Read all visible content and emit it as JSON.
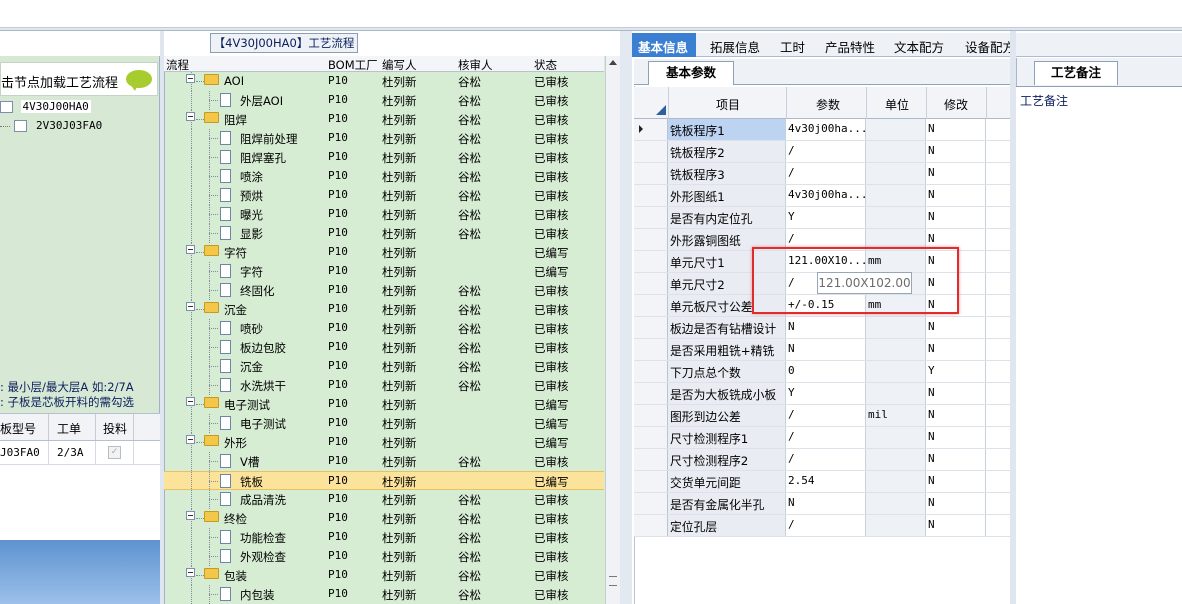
{
  "left_panel": {
    "title": "击节点加载工艺流程",
    "tree": [
      "4V30J00HA0",
      "2V30J03FA0"
    ],
    "note_line1": ": 最小层/最大层A 如:2/7A",
    "note_line2": ": 子板是芯板开料的需勾选",
    "grid_headers": [
      "板型号",
      "工单",
      "投料"
    ],
    "grid_row": {
      "model": "J03FA0",
      "order": "2/3A"
    }
  },
  "middle_panel": {
    "tab_title": "【4V30J00HA0】工艺流程",
    "headers": [
      "流程",
      "BOM工厂",
      "编写人",
      "核审人",
      "状态"
    ],
    "rows": [
      {
        "name": "AOI",
        "level": 0,
        "bom": "P10",
        "writer": "杜列新",
        "reviewer": "谷松",
        "status": "已审核"
      },
      {
        "name": "外层AOI",
        "level": 1,
        "bom": "P10",
        "writer": "杜列新",
        "reviewer": "谷松",
        "status": "已审核"
      },
      {
        "name": "阻焊",
        "level": 0,
        "bom": "P10",
        "writer": "杜列新",
        "reviewer": "谷松",
        "status": "已审核"
      },
      {
        "name": "阻焊前处理",
        "level": 1,
        "bom": "P10",
        "writer": "杜列新",
        "reviewer": "谷松",
        "status": "已审核"
      },
      {
        "name": "阻焊塞孔",
        "level": 1,
        "bom": "P10",
        "writer": "杜列新",
        "reviewer": "谷松",
        "status": "已审核"
      },
      {
        "name": "喷涂",
        "level": 1,
        "bom": "P10",
        "writer": "杜列新",
        "reviewer": "谷松",
        "status": "已审核"
      },
      {
        "name": "预烘",
        "level": 1,
        "bom": "P10",
        "writer": "杜列新",
        "reviewer": "谷松",
        "status": "已审核"
      },
      {
        "name": "曝光",
        "level": 1,
        "bom": "P10",
        "writer": "杜列新",
        "reviewer": "谷松",
        "status": "已审核"
      },
      {
        "name": "显影",
        "level": 1,
        "bom": "P10",
        "writer": "杜列新",
        "reviewer": "谷松",
        "status": "已审核"
      },
      {
        "name": "字符",
        "level": 0,
        "bom": "P10",
        "writer": "杜列新",
        "reviewer": "",
        "status": "已编写"
      },
      {
        "name": "字符",
        "level": 1,
        "bom": "P10",
        "writer": "杜列新",
        "reviewer": "",
        "status": "已编写"
      },
      {
        "name": "终固化",
        "level": 1,
        "bom": "P10",
        "writer": "杜列新",
        "reviewer": "谷松",
        "status": "已审核"
      },
      {
        "name": "沉金",
        "level": 0,
        "bom": "P10",
        "writer": "杜列新",
        "reviewer": "谷松",
        "status": "已审核"
      },
      {
        "name": "喷砂",
        "level": 1,
        "bom": "P10",
        "writer": "杜列新",
        "reviewer": "谷松",
        "status": "已审核"
      },
      {
        "name": "板边包胶",
        "level": 1,
        "bom": "P10",
        "writer": "杜列新",
        "reviewer": "谷松",
        "status": "已审核"
      },
      {
        "name": "沉金",
        "level": 1,
        "bom": "P10",
        "writer": "杜列新",
        "reviewer": "谷松",
        "status": "已审核"
      },
      {
        "name": "水洗烘干",
        "level": 1,
        "bom": "P10",
        "writer": "杜列新",
        "reviewer": "谷松",
        "status": "已审核"
      },
      {
        "name": "电子测试",
        "level": 0,
        "bom": "P10",
        "writer": "杜列新",
        "reviewer": "",
        "status": "已编写"
      },
      {
        "name": "电子测试",
        "level": 1,
        "bom": "P10",
        "writer": "杜列新",
        "reviewer": "",
        "status": "已编写"
      },
      {
        "name": "外形",
        "level": 0,
        "bom": "P10",
        "writer": "杜列新",
        "reviewer": "",
        "status": "已编写"
      },
      {
        "name": "V槽",
        "level": 1,
        "bom": "P10",
        "writer": "杜列新",
        "reviewer": "谷松",
        "status": "已审核"
      },
      {
        "name": "铣板",
        "level": 1,
        "bom": "P10",
        "writer": "杜列新",
        "reviewer": "",
        "status": "已编写",
        "selected": true
      },
      {
        "name": "成品清洗",
        "level": 1,
        "bom": "P10",
        "writer": "杜列新",
        "reviewer": "谷松",
        "status": "已审核"
      },
      {
        "name": "终检",
        "level": 0,
        "bom": "P10",
        "writer": "杜列新",
        "reviewer": "谷松",
        "status": "已审核"
      },
      {
        "name": "功能检查",
        "level": 1,
        "bom": "P10",
        "writer": "杜列新",
        "reviewer": "谷松",
        "status": "已审核"
      },
      {
        "name": "外观检查",
        "level": 1,
        "bom": "P10",
        "writer": "杜列新",
        "reviewer": "谷松",
        "status": "已审核"
      },
      {
        "name": "包装",
        "level": 0,
        "bom": "P10",
        "writer": "杜列新",
        "reviewer": "谷松",
        "status": "已审核"
      },
      {
        "name": "内包装",
        "level": 1,
        "bom": "P10",
        "writer": "杜列新",
        "reviewer": "谷松",
        "status": "已审核"
      }
    ]
  },
  "right_tabs": [
    "基本信息",
    "拓展信息",
    "工时",
    "产品特性",
    "文本配方",
    "设备配方"
  ],
  "params": {
    "tab": "基本参数",
    "headers": [
      "项目",
      "参数",
      "单位",
      "修改"
    ],
    "rows": [
      {
        "item": "铣板程序1",
        "value": "4v30j00ha...",
        "unit": "",
        "mod": "N"
      },
      {
        "item": "铣板程序2",
        "value": "/",
        "unit": "",
        "mod": "N"
      },
      {
        "item": "铣板程序3",
        "value": "/",
        "unit": "",
        "mod": "N"
      },
      {
        "item": "外形图纸1",
        "value": "4v30j00ha...",
        "unit": "",
        "mod": "N"
      },
      {
        "item": "是否有内定位孔",
        "value": "Y",
        "unit": "",
        "mod": "N"
      },
      {
        "item": "外形露铜图纸",
        "value": "/",
        "unit": "",
        "mod": "N"
      },
      {
        "item": "单元尺寸1",
        "value": "121.00X10...",
        "unit": "mm",
        "mod": "N"
      },
      {
        "item": "单元尺寸2",
        "value": "/",
        "unit": "",
        "mod": "N"
      },
      {
        "item": "单元板尺寸公差",
        "value": "+/-0.15",
        "unit": "mm",
        "mod": "N"
      },
      {
        "item": "板边是否有钻槽设计",
        "value": "N",
        "unit": "",
        "mod": "N"
      },
      {
        "item": "是否采用粗铣+精铣",
        "value": "N",
        "unit": "",
        "mod": "N"
      },
      {
        "item": "下刀点总个数",
        "value": "0",
        "unit": "",
        "mod": "Y"
      },
      {
        "item": "是否为大板铣成小板",
        "value": "Y",
        "unit": "",
        "mod": "N"
      },
      {
        "item": "图形到边公差",
        "value": "/",
        "unit": "mil",
        "mod": "N"
      },
      {
        "item": "尺寸检测程序1",
        "value": "/",
        "unit": "",
        "mod": "N"
      },
      {
        "item": "尺寸检测程序2",
        "value": "/",
        "unit": "",
        "mod": "N"
      },
      {
        "item": "交货单元间距",
        "value": "2.54",
        "unit": "",
        "mod": "N"
      },
      {
        "item": "是否有金属化半孔",
        "value": "N",
        "unit": "",
        "mod": "N"
      },
      {
        "item": "定位孔层",
        "value": "/",
        "unit": "",
        "mod": "N"
      }
    ],
    "tooltip": "121.00X102.00"
  },
  "notes_panel": {
    "tab": "工艺备注",
    "label": "工艺备注"
  }
}
